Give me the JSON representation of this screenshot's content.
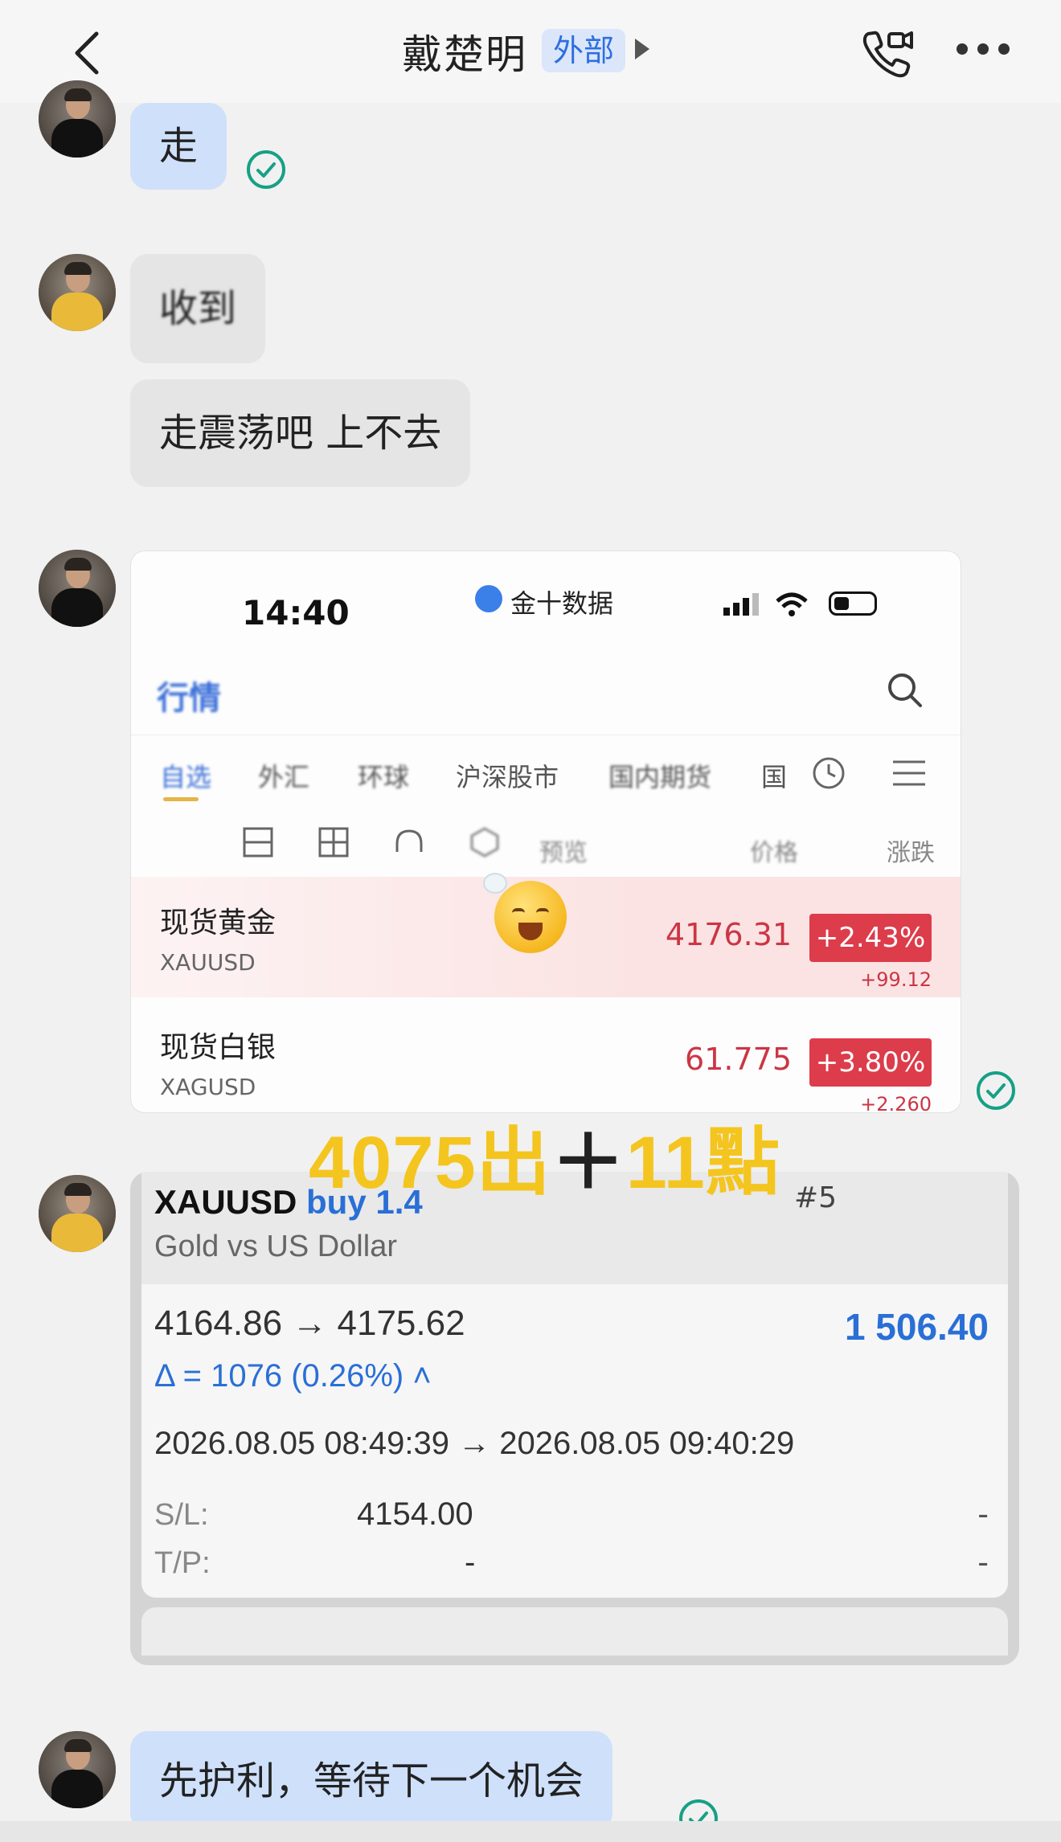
{
  "header": {
    "title": "戴楚明",
    "badge": "外部"
  },
  "messages": [
    {
      "side": "mine",
      "text": "走"
    },
    {
      "side": "other",
      "text": "收到"
    },
    {
      "side": "other",
      "text": "走震荡吧 上不去"
    }
  ],
  "market_screenshot": {
    "status_time": "14:40",
    "app_name": "金十数据",
    "page_title": "行情",
    "tabs": [
      "自选",
      "外汇",
      "环球",
      "沪深股市",
      "国内期货",
      "国"
    ],
    "columns": [
      "预览",
      "价格",
      "涨跌"
    ],
    "rows": [
      {
        "name": "现货黄金",
        "code": "XAUUSD",
        "price": "4176.31",
        "change_pct": "+2.43%",
        "change": "+99.12"
      },
      {
        "name": "现货白银",
        "code": "XAGUSD",
        "price": "61.775",
        "change_pct": "+3.80%",
        "change": "+2.260"
      }
    ]
  },
  "overlay": {
    "left": "4075出",
    "plus": "＋",
    "right": "11點"
  },
  "trade": {
    "symbol": "XAUUSD",
    "side": "buy 1.4",
    "ticket": "#5",
    "description": "Gold vs US Dollar",
    "prices": "4164.86 → 4175.62",
    "profit": "1 506.40",
    "delta": "Δ = 1076 (0.26%) ˄",
    "times": "2026.08.05 08:49:39 → 2026.08.05 09:40:29",
    "sl_label": "S/L:",
    "sl_value": "4154.00",
    "tp_label": "T/P:",
    "tp_value": "-",
    "right_dash_1": "-",
    "right_dash_2": "-"
  },
  "last_message": {
    "side": "mine",
    "text": "先护利，等待下一个机会"
  },
  "colors": {
    "accent": "#2e6fe0",
    "mine_bubble": "#cfe0fb",
    "other_bubble": "#e5e5e5",
    "up_red": "#dd3c4b",
    "overlay_yellow": "#f4c51f",
    "read_check": "#17a086"
  }
}
